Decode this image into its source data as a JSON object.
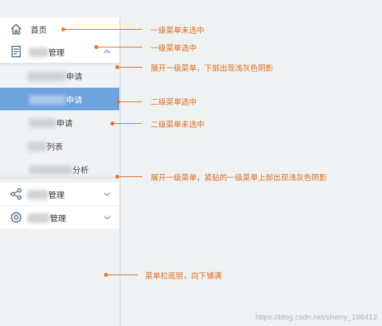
{
  "menu": {
    "home": "首页",
    "item1_suffix": "管理",
    "sub": {
      "item1_suffix": "申请",
      "item2_suffix": "申请",
      "item3_suffix": "申请",
      "item4_suffix": "列表",
      "item5_suffix": "分析"
    },
    "item2_suffix": "管理",
    "item3_suffix": "管理"
  },
  "annotations": {
    "a1": "一级菜单未选中",
    "a2": "一级菜单选中",
    "a3": "展开一级菜单，下部出现浅灰色阴影",
    "a4": "二级菜单选中",
    "a5": "二级菜单未选中",
    "a6": "展开一级菜单，紧贴的一级菜单上部出现浅灰色阴影",
    "a7": "菜单栏底层，向下铺满"
  },
  "watermark": "https://blog.csdn.net/sherry_198412",
  "colors": {
    "selected": "#6fa3de",
    "annotation": "#e8772d",
    "background": "#eef2f3"
  }
}
